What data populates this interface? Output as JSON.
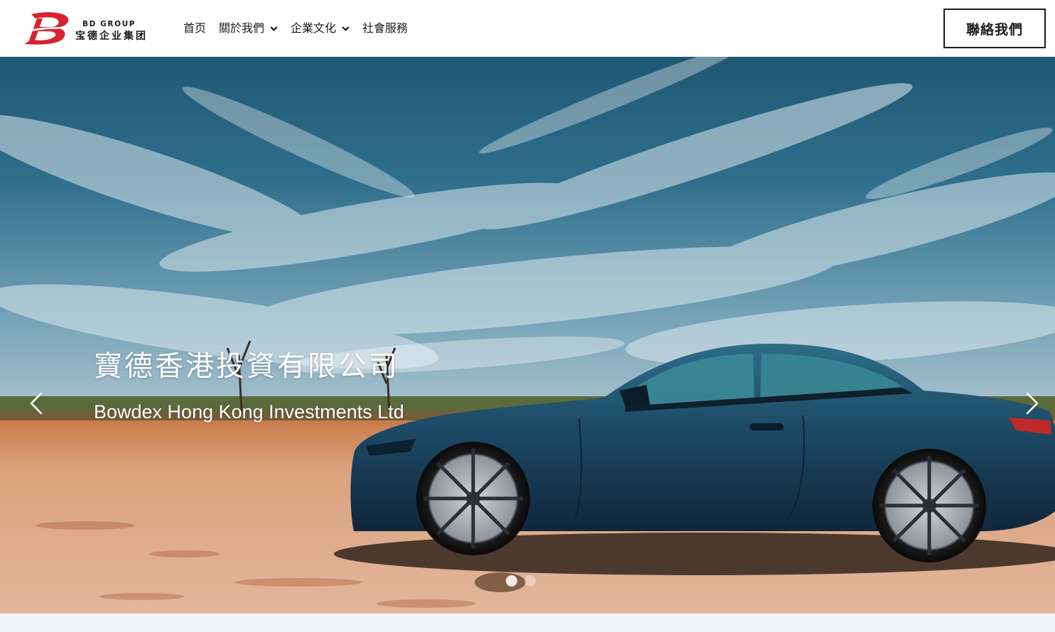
{
  "brand": {
    "logo_letter": "B",
    "name_en": "BD GROUP",
    "name_cn": "宝德企业集团",
    "accent_color": "#d8222f"
  },
  "nav": {
    "items": [
      {
        "label": "首页",
        "has_dropdown": false
      },
      {
        "label": "關於我們",
        "has_dropdown": true,
        "icon": "chevron-down-icon"
      },
      {
        "label": "企業文化",
        "has_dropdown": true,
        "icon": "chevron-down-icon"
      },
      {
        "label": "社會服務",
        "has_dropdown": false
      }
    ],
    "contact_label": "聯絡我們"
  },
  "hero": {
    "title": "寶德香港投資有限公司",
    "subtitle": "Bowdex Hong Kong Investments Ltd",
    "image_subject": "blue coupe parked on a dry lakebed under a cloudy blue sky",
    "prev_icon": "chevron-left-icon",
    "next_icon": "chevron-right-icon",
    "slides_count": 2,
    "active_slide": 1
  }
}
